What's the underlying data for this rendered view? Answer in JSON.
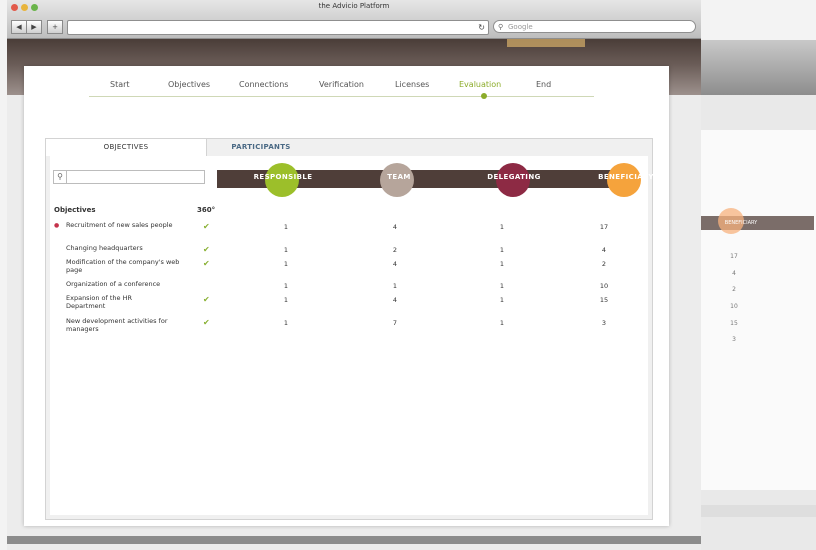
{
  "window": {
    "title": "the Advicio Platform",
    "search_placeholder": "Google"
  },
  "steps": [
    {
      "label": "Start"
    },
    {
      "label": "Objectives"
    },
    {
      "label": "Connections"
    },
    {
      "label": "Verification"
    },
    {
      "label": "Licenses"
    },
    {
      "label": "Evaluation",
      "active": true
    },
    {
      "label": "End"
    }
  ],
  "tabs": {
    "objectives": "OBJECTIVES",
    "participants": "PARTICIPANTS"
  },
  "table": {
    "header_objectives": "Objectives",
    "header_360": "360°",
    "roles": [
      "RESPONSIBLE",
      "TEAM",
      "DELEGATING",
      "BENEFICIARY"
    ],
    "rows": [
      {
        "label": "Recruitment of new sales people",
        "check": true,
        "bullet": true,
        "values": [
          "1",
          "4",
          "1",
          "17"
        ]
      },
      {
        "label": "Changing headquarters",
        "check": true,
        "bullet": false,
        "values": [
          "1",
          "2",
          "1",
          "4"
        ]
      },
      {
        "label": "Modification of the company's web page",
        "check": true,
        "bullet": false,
        "values": [
          "1",
          "4",
          "1",
          "2"
        ]
      },
      {
        "label": "Organization of a conference",
        "check": false,
        "bullet": false,
        "values": [
          "1",
          "1",
          "1",
          "10"
        ]
      },
      {
        "label": "Expansion of the HR Department",
        "check": true,
        "bullet": false,
        "values": [
          "1",
          "4",
          "1",
          "15"
        ]
      },
      {
        "label": "New development activities for managers",
        "check": true,
        "bullet": false,
        "values": [
          "1",
          "7",
          "1",
          "3"
        ]
      }
    ]
  },
  "background": {
    "role_label": "BENEFICIARY",
    "values": [
      "17",
      "4",
      "2",
      "10",
      "15",
      "3"
    ]
  },
  "colors": {
    "responsible": "#9cbf2a",
    "team": "#b6a59b",
    "delegating": "#8d2a44",
    "beneficiary": "#f5a33c",
    "accent": "#8cac2a"
  },
  "icons": {
    "check": "✔",
    "bullet": "●",
    "search": "⚲"
  }
}
